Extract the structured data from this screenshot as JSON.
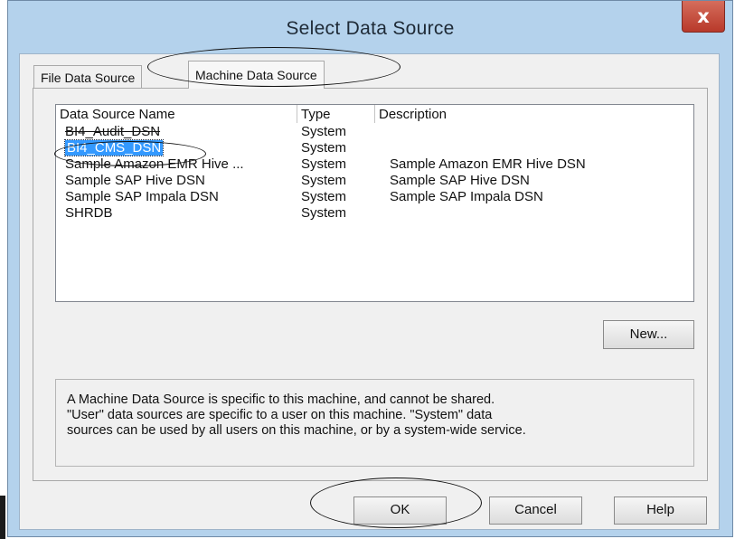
{
  "window": {
    "title": "Select Data Source",
    "close_glyph": "x"
  },
  "tabs": [
    {
      "label": "File Data Source",
      "active": false
    },
    {
      "label": "Machine Data Source",
      "active": true
    }
  ],
  "list": {
    "columns": [
      "Data Source Name",
      "Type",
      "Description"
    ],
    "rows": [
      {
        "name": "BI4_Audit_DSN",
        "type": "System",
        "description": ""
      },
      {
        "name": "BI4_CMS_DSN",
        "type": "System",
        "description": "",
        "selected": true
      },
      {
        "name": "Sample Amazon EMR Hive ...",
        "type": "System",
        "description": "Sample Amazon EMR Hive DSN"
      },
      {
        "name": "Sample SAP Hive DSN",
        "type": "System",
        "description": "Sample SAP Hive DSN"
      },
      {
        "name": "Sample SAP Impala DSN",
        "type": "System",
        "description": "Sample SAP Impala DSN"
      },
      {
        "name": "SHRDB",
        "type": "System",
        "description": ""
      }
    ]
  },
  "buttons": {
    "new": "New...",
    "ok": "OK",
    "cancel": "Cancel",
    "help": "Help"
  },
  "description_lines": [
    "A Machine Data Source is specific to this machine, and cannot be shared.",
    "\"User\" data sources are specific to a user on this machine.  \"System\" data",
    "sources can be used by all users on this machine, or by a system-wide service."
  ],
  "colors": {
    "title_bar": "#b4d2ec",
    "close_button": "#c7493a",
    "selection": "#3399ff",
    "dialog_bg": "#f0f0f0"
  }
}
